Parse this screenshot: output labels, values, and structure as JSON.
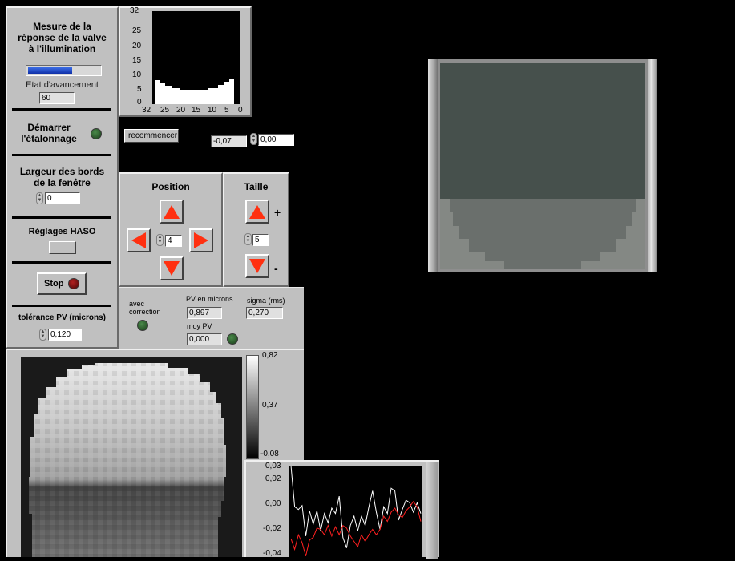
{
  "left_panel": {
    "title_line1": "Mesure de la",
    "title_line2": "réponse de la valve",
    "title_line3": "à l'illumination",
    "progress_fraction": 0.62,
    "progress_label": "Etat d'avancement",
    "progress_value": "60",
    "start_label_line1": "Démarrer",
    "start_label_line2": "l'étalonnage",
    "border_width_label_line1": "Largeur des bords",
    "border_width_label_line2": "de la fenêtre",
    "border_width_value": "0",
    "haso_label": "Réglages HASO",
    "stop_label": "Stop",
    "pv_tolerance_label": "tolérance PV (microns)",
    "pv_tolerance_value": "0,120"
  },
  "histogram": {
    "y_ticks": [
      "32",
      "25",
      "20",
      "15",
      "10",
      "5",
      "0"
    ],
    "x_ticks": [
      "32",
      "25",
      "20",
      "15",
      "10",
      "5",
      "0"
    ]
  },
  "controls": {
    "restart_label": "recommencer",
    "offset_value": "-0,07",
    "offset_set_value": "0,00"
  },
  "position_panel": {
    "title": "Position",
    "step_value": "4"
  },
  "size_panel": {
    "title": "Taille",
    "plus": "+",
    "minus": "-",
    "size_value": "5"
  },
  "stats_panel": {
    "correction_label_line1": "avec",
    "correction_label_line2": "correction",
    "pv_label": "PV en microns",
    "pv_value": "0,897",
    "sigma_label": "sigma (rms)",
    "sigma_value": "0,270",
    "mean_pv_label": "moy PV",
    "mean_pv_value": "0,000"
  },
  "colorbar": {
    "ticks": [
      "0,82",
      "0,37",
      "-0,08"
    ]
  },
  "line_plot": {
    "y_ticks": [
      "0,03",
      "0,02",
      "0,00",
      "-0,02",
      "-0,04"
    ]
  },
  "chart_data": {
    "type": "line",
    "ylim": [
      -0.04,
      0.03
    ],
    "series": [
      {
        "color": "#ffffff",
        "values": [
          0.03,
          -0.001,
          -0.003,
          0.0,
          -0.023,
          -0.004,
          -0.014,
          -0.004,
          -0.019,
          -0.006,
          -0.013,
          -0.002,
          -0.006,
          0.007,
          -0.024,
          -0.032,
          -0.015,
          -0.008,
          -0.019,
          -0.008,
          -0.015,
          -0.001,
          0.011,
          -0.005,
          -0.018,
          -0.001,
          -0.006,
          0.013,
          0.011,
          -0.011,
          -0.003,
          0.004,
          0.002,
          -0.005,
          0.002,
          -0.006
        ]
      },
      {
        "color": "#ff2020",
        "values": [
          -0.025,
          -0.033,
          -0.022,
          -0.028,
          -0.038,
          -0.026,
          -0.024,
          -0.017,
          -0.018,
          -0.022,
          -0.015,
          -0.023,
          -0.016,
          -0.022,
          -0.015,
          -0.017,
          -0.023,
          -0.027,
          -0.031,
          -0.022,
          -0.027,
          -0.022,
          -0.018,
          -0.022,
          -0.018,
          -0.008,
          -0.012,
          -0.005,
          -0.002,
          -0.007,
          -0.009,
          -0.004,
          -0.001,
          0.003,
          -0.001,
          -0.012
        ]
      }
    ]
  }
}
